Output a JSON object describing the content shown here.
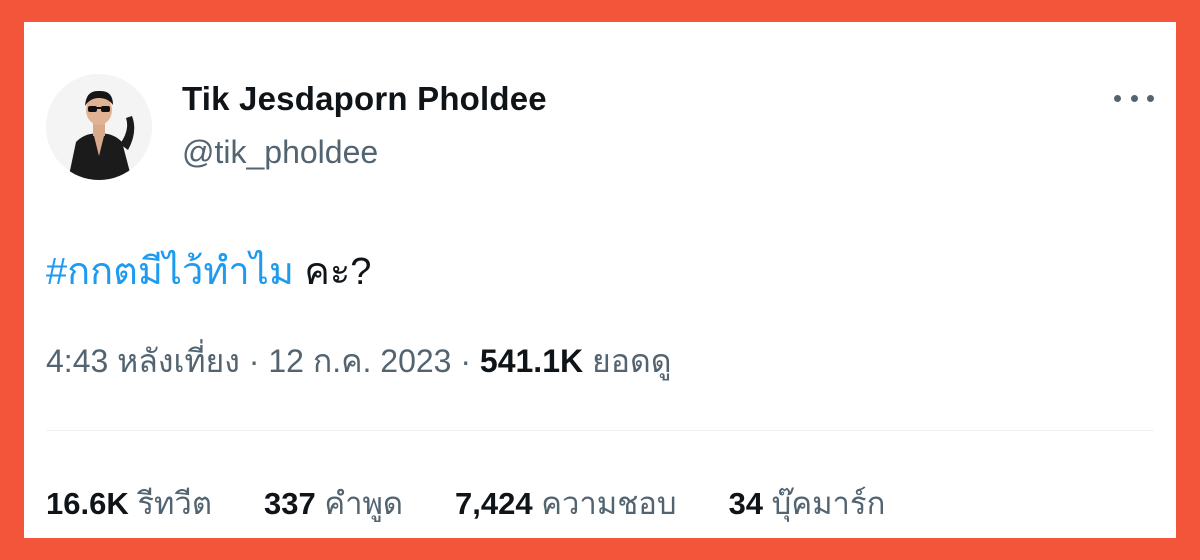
{
  "colors": {
    "frame": "#f2553a",
    "card": "#ffffff",
    "text": "#0f1419",
    "secondary": "#536471",
    "link": "#1d9bf0"
  },
  "author": {
    "display_name": "Tik Jesdaporn Pholdee",
    "handle": "@tik_pholdee"
  },
  "more_icon": "more-horizontal-icon",
  "tweet": {
    "hashtag": "#กกตมีไว้ทำไม",
    "text": " คะ?"
  },
  "meta": {
    "time": "4:43 หลังเที่ยง",
    "sep1": " · ",
    "date": "12 ก.ค. 2023",
    "sep2": " · ",
    "views_count": "541.1K",
    "views_label": " ยอดดู"
  },
  "stats": {
    "retweets": {
      "count": "16.6K",
      "label": " รีทวีต"
    },
    "quotes": {
      "count": "337",
      "label": " คำพูด"
    },
    "likes": {
      "count": "7,424",
      "label": " ความชอบ"
    },
    "bookmarks": {
      "count": "34",
      "label": " บุ๊คมาร์ก"
    }
  }
}
